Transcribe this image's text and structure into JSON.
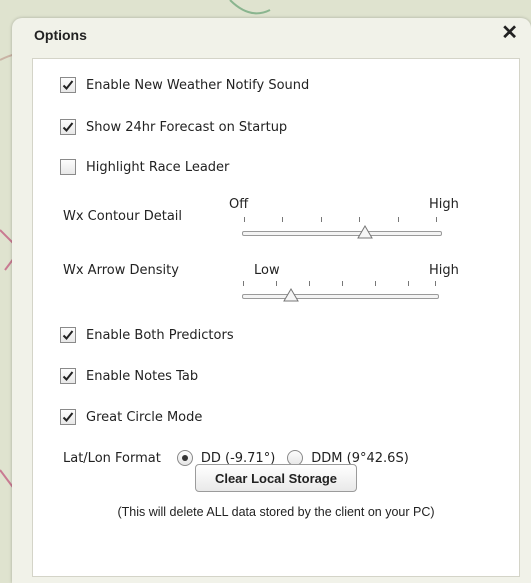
{
  "dialog": {
    "title": "Options",
    "close_label": "✕"
  },
  "checkboxes_top": [
    {
      "label": "Enable New Weather Notify Sound",
      "checked": true
    },
    {
      "label": "Show 24hr Forecast on Startup",
      "checked": true
    },
    {
      "label": "Highlight Race Leader",
      "checked": false
    }
  ],
  "contour": {
    "label": "Wx Contour Detail",
    "min_label": "Off",
    "max_label": "High",
    "level": 0.62
  },
  "arrow": {
    "label": "Wx Arrow Density",
    "min_label": "Low",
    "max_label": "High",
    "level": 0.25
  },
  "checkboxes_bottom": [
    {
      "label": "Enable Both Predictors",
      "checked": true
    },
    {
      "label": "Enable Notes Tab",
      "checked": true
    },
    {
      "label": "Great Circle Mode",
      "checked": true
    }
  ],
  "latlon": {
    "label": "Lat/Lon Format",
    "options": [
      {
        "label": "DD (-9.71°)",
        "selected": true
      },
      {
        "label": "DDM (9°42.6S)",
        "selected": false
      }
    ]
  },
  "storage": {
    "button_label": "Clear Local Storage",
    "note": "(This will delete ALL data stored by the client on your PC)"
  },
  "colors": {
    "map": "#dfe3cf",
    "dialog": "#f1f2e9",
    "panel": "#ffffff"
  }
}
